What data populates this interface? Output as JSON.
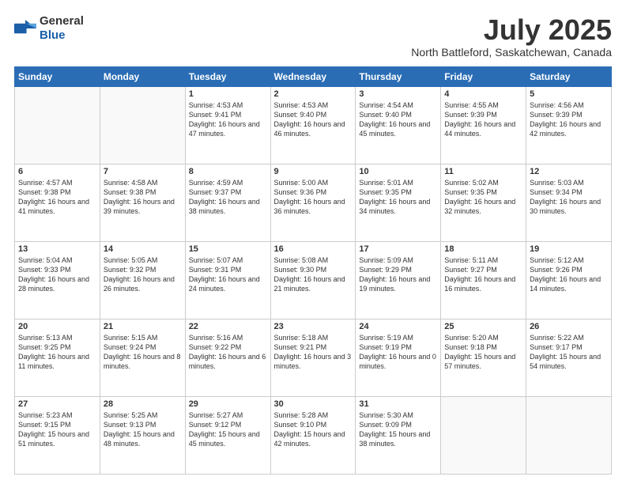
{
  "logo": {
    "general": "General",
    "blue": "Blue"
  },
  "header": {
    "month": "July 2025",
    "location": "North Battleford, Saskatchewan, Canada"
  },
  "weekdays": [
    "Sunday",
    "Monday",
    "Tuesday",
    "Wednesday",
    "Thursday",
    "Friday",
    "Saturday"
  ],
  "weeks": [
    [
      {
        "day": "",
        "info": ""
      },
      {
        "day": "",
        "info": ""
      },
      {
        "day": "1",
        "info": "Sunrise: 4:53 AM\nSunset: 9:41 PM\nDaylight: 16 hours and 47 minutes."
      },
      {
        "day": "2",
        "info": "Sunrise: 4:53 AM\nSunset: 9:40 PM\nDaylight: 16 hours and 46 minutes."
      },
      {
        "day": "3",
        "info": "Sunrise: 4:54 AM\nSunset: 9:40 PM\nDaylight: 16 hours and 45 minutes."
      },
      {
        "day": "4",
        "info": "Sunrise: 4:55 AM\nSunset: 9:39 PM\nDaylight: 16 hours and 44 minutes."
      },
      {
        "day": "5",
        "info": "Sunrise: 4:56 AM\nSunset: 9:39 PM\nDaylight: 16 hours and 42 minutes."
      }
    ],
    [
      {
        "day": "6",
        "info": "Sunrise: 4:57 AM\nSunset: 9:38 PM\nDaylight: 16 hours and 41 minutes."
      },
      {
        "day": "7",
        "info": "Sunrise: 4:58 AM\nSunset: 9:38 PM\nDaylight: 16 hours and 39 minutes."
      },
      {
        "day": "8",
        "info": "Sunrise: 4:59 AM\nSunset: 9:37 PM\nDaylight: 16 hours and 38 minutes."
      },
      {
        "day": "9",
        "info": "Sunrise: 5:00 AM\nSunset: 9:36 PM\nDaylight: 16 hours and 36 minutes."
      },
      {
        "day": "10",
        "info": "Sunrise: 5:01 AM\nSunset: 9:35 PM\nDaylight: 16 hours and 34 minutes."
      },
      {
        "day": "11",
        "info": "Sunrise: 5:02 AM\nSunset: 9:35 PM\nDaylight: 16 hours and 32 minutes."
      },
      {
        "day": "12",
        "info": "Sunrise: 5:03 AM\nSunset: 9:34 PM\nDaylight: 16 hours and 30 minutes."
      }
    ],
    [
      {
        "day": "13",
        "info": "Sunrise: 5:04 AM\nSunset: 9:33 PM\nDaylight: 16 hours and 28 minutes."
      },
      {
        "day": "14",
        "info": "Sunrise: 5:05 AM\nSunset: 9:32 PM\nDaylight: 16 hours and 26 minutes."
      },
      {
        "day": "15",
        "info": "Sunrise: 5:07 AM\nSunset: 9:31 PM\nDaylight: 16 hours and 24 minutes."
      },
      {
        "day": "16",
        "info": "Sunrise: 5:08 AM\nSunset: 9:30 PM\nDaylight: 16 hours and 21 minutes."
      },
      {
        "day": "17",
        "info": "Sunrise: 5:09 AM\nSunset: 9:29 PM\nDaylight: 16 hours and 19 minutes."
      },
      {
        "day": "18",
        "info": "Sunrise: 5:11 AM\nSunset: 9:27 PM\nDaylight: 16 hours and 16 minutes."
      },
      {
        "day": "19",
        "info": "Sunrise: 5:12 AM\nSunset: 9:26 PM\nDaylight: 16 hours and 14 minutes."
      }
    ],
    [
      {
        "day": "20",
        "info": "Sunrise: 5:13 AM\nSunset: 9:25 PM\nDaylight: 16 hours and 11 minutes."
      },
      {
        "day": "21",
        "info": "Sunrise: 5:15 AM\nSunset: 9:24 PM\nDaylight: 16 hours and 8 minutes."
      },
      {
        "day": "22",
        "info": "Sunrise: 5:16 AM\nSunset: 9:22 PM\nDaylight: 16 hours and 6 minutes."
      },
      {
        "day": "23",
        "info": "Sunrise: 5:18 AM\nSunset: 9:21 PM\nDaylight: 16 hours and 3 minutes."
      },
      {
        "day": "24",
        "info": "Sunrise: 5:19 AM\nSunset: 9:19 PM\nDaylight: 16 hours and 0 minutes."
      },
      {
        "day": "25",
        "info": "Sunrise: 5:20 AM\nSunset: 9:18 PM\nDaylight: 15 hours and 57 minutes."
      },
      {
        "day": "26",
        "info": "Sunrise: 5:22 AM\nSunset: 9:17 PM\nDaylight: 15 hours and 54 minutes."
      }
    ],
    [
      {
        "day": "27",
        "info": "Sunrise: 5:23 AM\nSunset: 9:15 PM\nDaylight: 15 hours and 51 minutes."
      },
      {
        "day": "28",
        "info": "Sunrise: 5:25 AM\nSunset: 9:13 PM\nDaylight: 15 hours and 48 minutes."
      },
      {
        "day": "29",
        "info": "Sunrise: 5:27 AM\nSunset: 9:12 PM\nDaylight: 15 hours and 45 minutes."
      },
      {
        "day": "30",
        "info": "Sunrise: 5:28 AM\nSunset: 9:10 PM\nDaylight: 15 hours and 42 minutes."
      },
      {
        "day": "31",
        "info": "Sunrise: 5:30 AM\nSunset: 9:09 PM\nDaylight: 15 hours and 38 minutes."
      },
      {
        "day": "",
        "info": ""
      },
      {
        "day": "",
        "info": ""
      }
    ]
  ]
}
